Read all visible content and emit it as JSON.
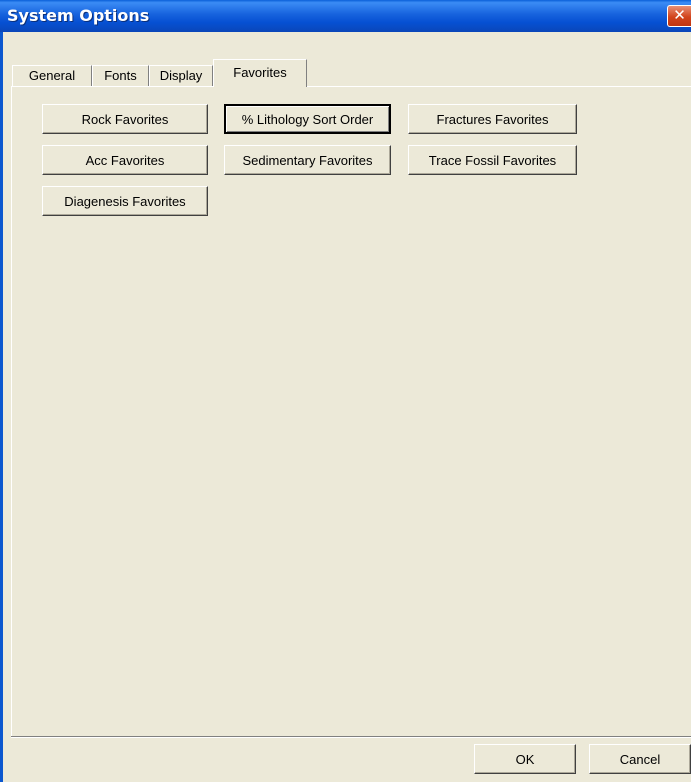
{
  "window": {
    "title": "System Options"
  },
  "title_buttons": {
    "close_glyph": "✕"
  },
  "tabs": [
    {
      "label": "General",
      "active": false
    },
    {
      "label": "Fonts",
      "active": false
    },
    {
      "label": "Display",
      "active": false
    },
    {
      "label": "Favorites",
      "active": true
    }
  ],
  "favorites": {
    "buttons": [
      {
        "label": "Rock Favorites"
      },
      {
        "label": "% Lithology Sort Order",
        "default": true
      },
      {
        "label": "Fractures Favorites"
      },
      {
        "label": "Acc Favorites"
      },
      {
        "label": "Sedimentary Favorites"
      },
      {
        "label": "Trace Fossil Favorites"
      },
      {
        "label": "Diagenesis Favorites"
      }
    ]
  },
  "footer": {
    "ok_label": "OK",
    "cancel_label": "Cancel"
  },
  "colors": {
    "titlebar": "#0a5fd8",
    "face": "#ece9d8",
    "close": "#d2441c"
  }
}
